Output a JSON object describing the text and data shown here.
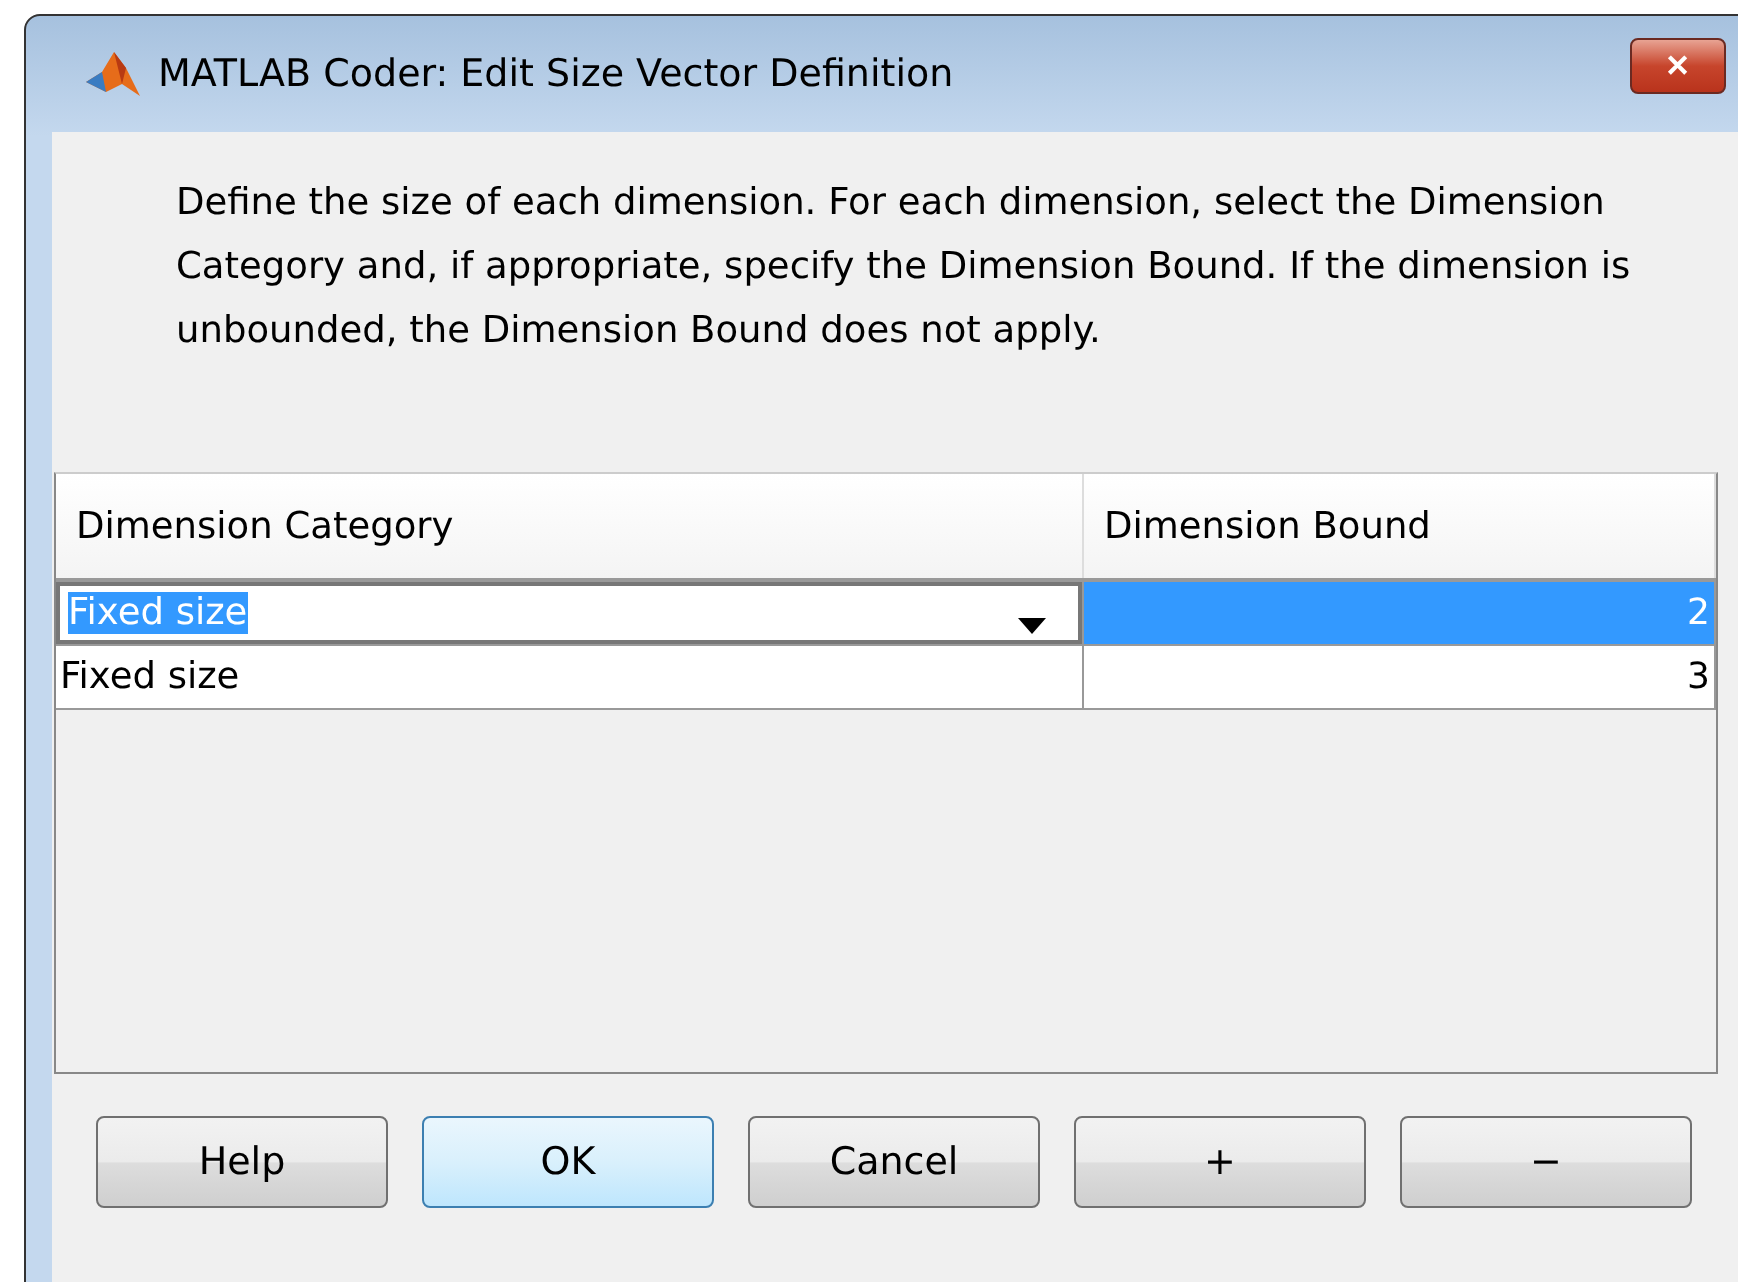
{
  "window": {
    "title": "MATLAB Coder: Edit Size Vector Definition",
    "close": "✕"
  },
  "description": "Define the size of each dimension. For each dimension, select the Dimension Category and, if appropriate, specify the Dimension Bound. If the dimension is unbounded, the Dimension Bound does not apply.",
  "table": {
    "columns": [
      "Dimension Category",
      "Dimension Bound"
    ],
    "rows": [
      {
        "category": "Fixed size",
        "bound": "2",
        "selected": true
      },
      {
        "category": "Fixed size",
        "bound": "3",
        "selected": false
      }
    ]
  },
  "buttons": [
    {
      "label": "Help",
      "default": false
    },
    {
      "label": "OK",
      "default": true
    },
    {
      "label": "Cancel",
      "default": false
    },
    {
      "label": "+",
      "default": false
    },
    {
      "label": "−",
      "default": false
    }
  ]
}
